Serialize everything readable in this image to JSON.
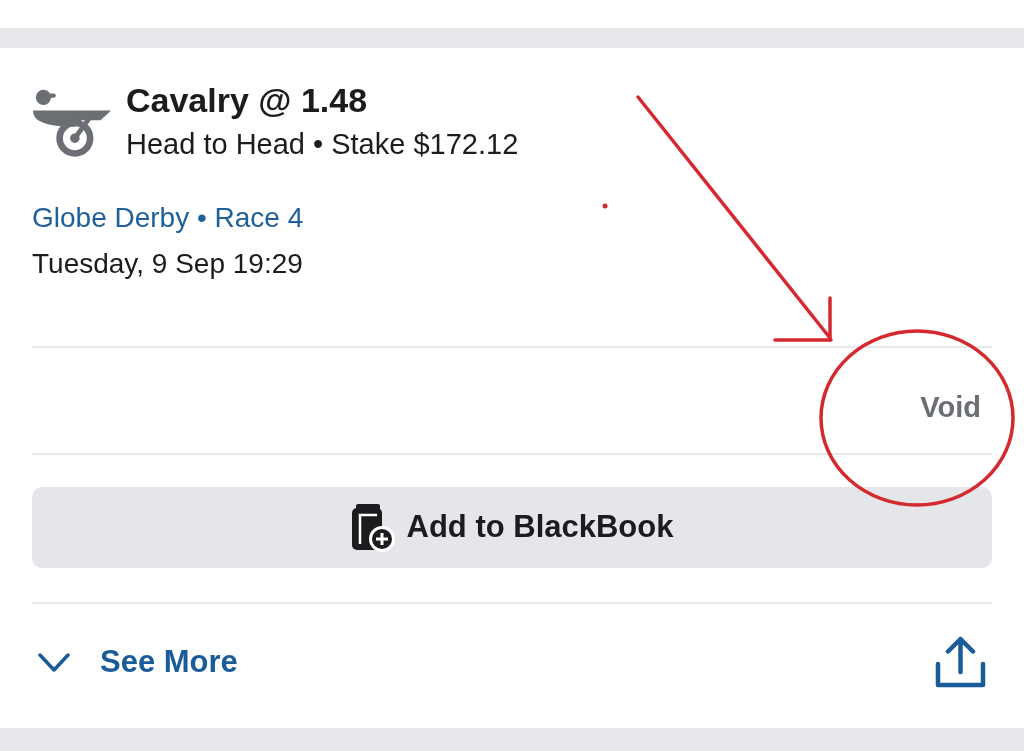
{
  "bet": {
    "selection": "Cavalry @ 1.48",
    "details": "Head to Head • Stake $172.12",
    "venue": "Globe Derby • Race 4",
    "datetime": "Tuesday, 9 Sep 19:29",
    "result": "Void"
  },
  "actions": {
    "blackbook_button": "Add to BlackBook",
    "see_more": "See More",
    "see_more_expanded": false
  },
  "annotations": [
    {
      "kind": "arrow"
    },
    {
      "kind": "circle"
    },
    {
      "kind": "dot"
    }
  ]
}
